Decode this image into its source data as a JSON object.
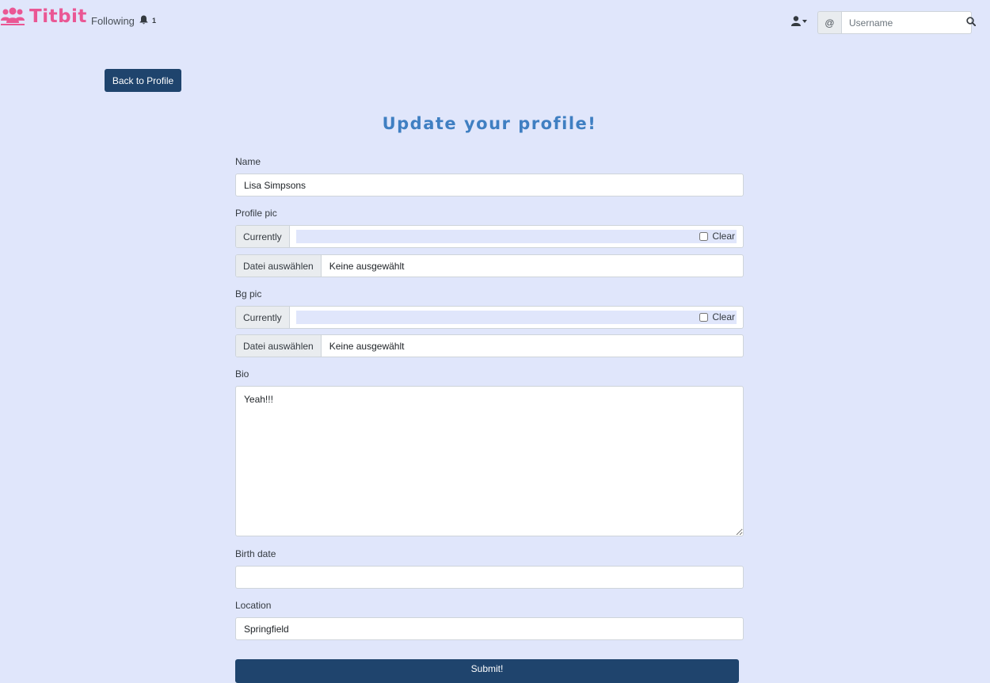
{
  "nav": {
    "brand": "Titbit",
    "following": "Following",
    "notification_count": "1",
    "search": {
      "addon": "@",
      "placeholder": "Username",
      "value": ""
    }
  },
  "back_button": "Back to Profile",
  "form": {
    "title": "Update your profile!",
    "name": {
      "label": "Name",
      "value": "Lisa Simpsons"
    },
    "profile_pic": {
      "label": "Profile pic",
      "currently_label": "Currently",
      "clear_label": "Clear",
      "choose_label": "Datei auswählen",
      "file_value": "Keine ausgewählt"
    },
    "bg_pic": {
      "label": "Bg pic",
      "currently_label": "Currently",
      "clear_label": "Clear",
      "choose_label": "Datei auswählen",
      "file_value": "Keine ausgewählt"
    },
    "bio": {
      "label": "Bio",
      "value": "Yeah!!!"
    },
    "birth_date": {
      "label": "Birth date",
      "value": ""
    },
    "location": {
      "label": "Location",
      "value": "Springfield"
    },
    "submit": "Submit!"
  },
  "colors": {
    "background": "#e0e6fb",
    "brand": "#ea5794",
    "primary_button": "#1f446d",
    "title": "#3f7fc2"
  },
  "icons": [
    "users-icon",
    "bell-icon",
    "user-icon",
    "search-icon"
  ]
}
